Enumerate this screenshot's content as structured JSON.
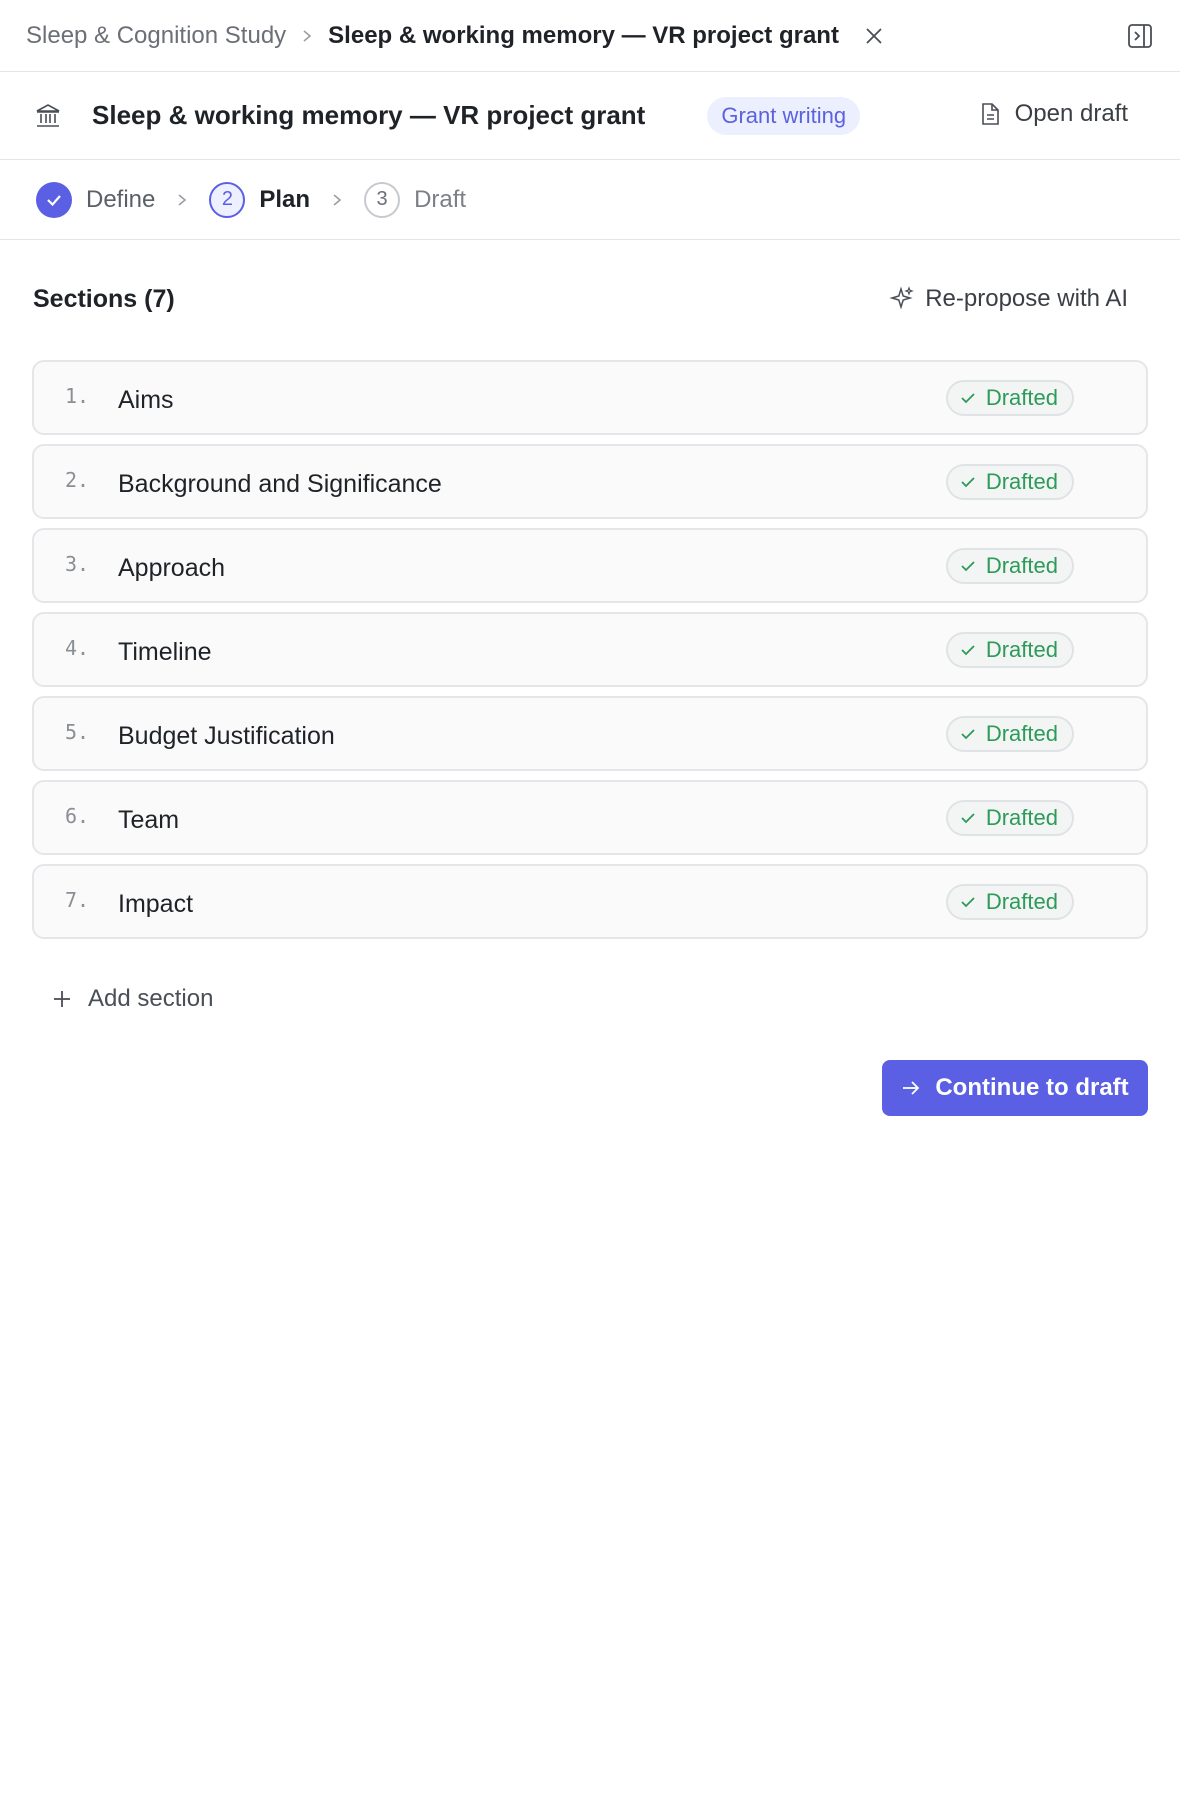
{
  "breadcrumb": {
    "parent": "Sleep & Cognition Study",
    "current": "Sleep & working memory — VR project grant"
  },
  "header": {
    "title": "Sleep & working memory — VR project grant",
    "badge": "Grant writing",
    "open_draft_label": "Open draft"
  },
  "stepper": {
    "steps": [
      {
        "number": "1",
        "label": "Define",
        "state": "done"
      },
      {
        "number": "2",
        "label": "Plan",
        "state": "active"
      },
      {
        "number": "3",
        "label": "Draft",
        "state": "pending"
      }
    ]
  },
  "sections": {
    "heading": "Sections (7)",
    "repropose_label": "Re-propose with AI",
    "items": [
      {
        "num": "1.",
        "title": "Aims",
        "status": "Drafted"
      },
      {
        "num": "2.",
        "title": "Background and Significance",
        "status": "Drafted"
      },
      {
        "num": "3.",
        "title": "Approach",
        "status": "Drafted"
      },
      {
        "num": "4.",
        "title": "Timeline",
        "status": "Drafted"
      },
      {
        "num": "5.",
        "title": "Budget Justification",
        "status": "Drafted"
      },
      {
        "num": "6.",
        "title": "Team",
        "status": "Drafted"
      },
      {
        "num": "7.",
        "title": "Impact",
        "status": "Drafted"
      }
    ],
    "add_label": "Add section"
  },
  "footer": {
    "continue_label": "Continue to draft"
  },
  "colors": {
    "accent": "#5a5fe3",
    "badge_bg": "#eceffe",
    "status_green": "#2c9a58"
  },
  "icons": {
    "breadcrumb_separator": "chevron-right-icon",
    "close": "close-icon",
    "panel_toggle": "sidebar-right-icon",
    "header": "bank-icon",
    "open_draft": "document-icon",
    "step_done": "check-icon",
    "repropose": "sparkle-icon",
    "status": "check-icon",
    "add": "plus-icon",
    "continue": "arrow-right-icon"
  }
}
